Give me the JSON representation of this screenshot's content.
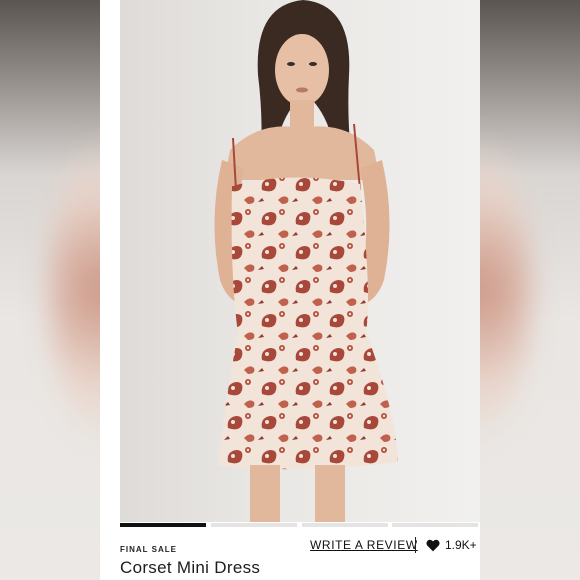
{
  "product": {
    "badge": "FINAL SALE",
    "title": "Corset Mini Dress"
  },
  "actions": {
    "write_review": "WRITE A REVIEW",
    "likes_count": "1.9K+"
  },
  "gallery": {
    "image_count": 4,
    "active_index": 0
  },
  "colors": {
    "pattern_red": "#a8483a",
    "dress_base": "#f2e4d8",
    "accent_dark": "#111111"
  }
}
